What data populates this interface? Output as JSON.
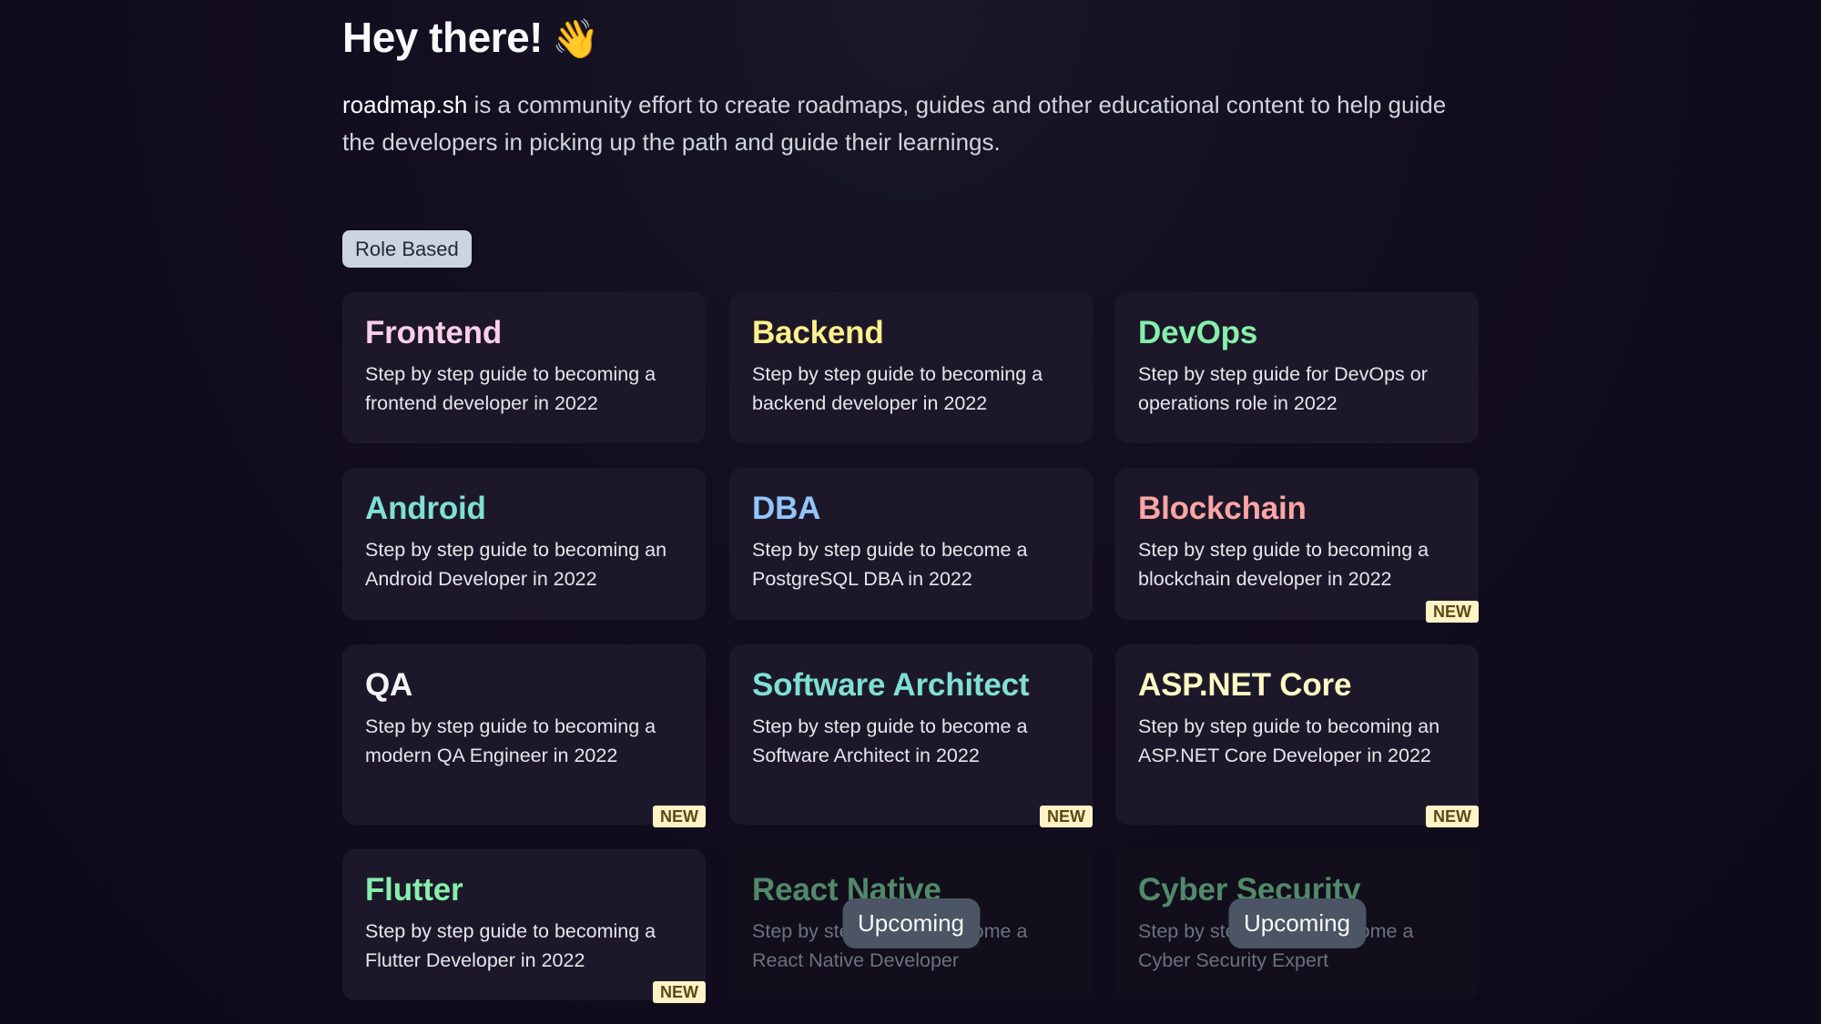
{
  "header": {
    "title": "Hey there!",
    "wave_emoji": "👋",
    "intro_brand": "roadmap.sh",
    "intro_rest": " is a community effort to create roadmaps, guides and other educational content to help guide the developers in picking up the path and guide their learnings."
  },
  "section": {
    "label": "Role Based"
  },
  "labels": {
    "new": "NEW",
    "upcoming": "Upcoming"
  },
  "cards": [
    {
      "title": "Frontend",
      "description": "Step by step guide to becoming a frontend developer in 2022",
      "color": "#fbcfe8",
      "is_new": false,
      "upcoming": false
    },
    {
      "title": "Backend",
      "description": "Step by step guide to becoming a backend developer in 2022",
      "color": "#fef08a",
      "is_new": false,
      "upcoming": false
    },
    {
      "title": "DevOps",
      "description": "Step by step guide for DevOps or operations role in 2022",
      "color": "#86efac",
      "is_new": false,
      "upcoming": false
    },
    {
      "title": "Android",
      "description": "Step by step guide to becoming an Android Developer in 2022",
      "color": "#7ee0d3",
      "is_new": false,
      "upcoming": false
    },
    {
      "title": "DBA",
      "description": "Step by step guide to become a PostgreSQL DBA in 2022",
      "color": "#93c5fd",
      "is_new": false,
      "upcoming": false
    },
    {
      "title": "Blockchain",
      "description": "Step by step guide to becoming a blockchain developer in 2022",
      "color": "#fca5a5",
      "is_new": true,
      "upcoming": false
    },
    {
      "title": "QA",
      "description": "Step by step guide to becoming a modern QA Engineer in 2022",
      "color": "#f3f4f6",
      "is_new": true,
      "upcoming": false
    },
    {
      "title": "Software Architect",
      "description": "Step by step guide to become a Software Architect in 2022",
      "color": "#7ee0d3",
      "is_new": true,
      "upcoming": false
    },
    {
      "title": "ASP.NET Core",
      "description": "Step by step guide to becoming an ASP.NET Core Developer in 2022",
      "color": "#fef9c3",
      "is_new": true,
      "upcoming": false
    },
    {
      "title": "Flutter",
      "description": "Step by step guide to becoming a Flutter Developer in 2022",
      "color": "#86efac",
      "is_new": true,
      "upcoming": false
    },
    {
      "title": "React Native",
      "description": "Step by step guide to become a React Native Developer",
      "color": "#86efac",
      "is_new": false,
      "upcoming": true
    },
    {
      "title": "Cyber Security",
      "description": "Step by step guide to become a Cyber Security Expert",
      "color": "#86efac",
      "is_new": false,
      "upcoming": true
    }
  ]
}
